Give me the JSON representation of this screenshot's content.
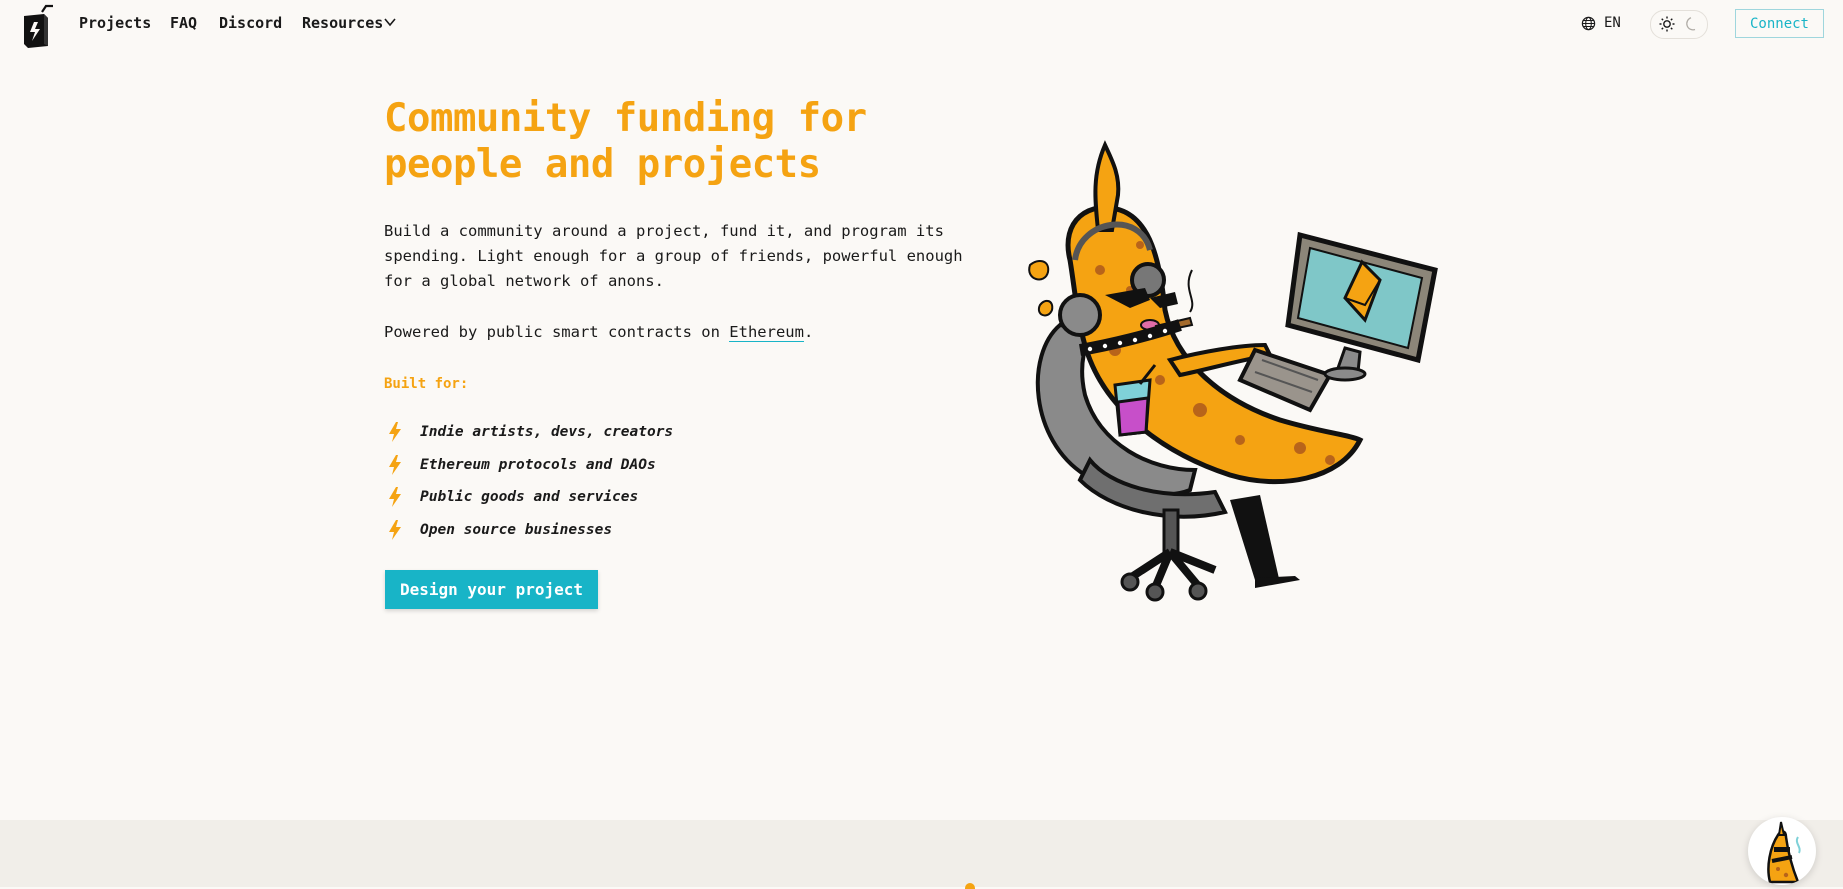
{
  "nav": {
    "links": [
      "Projects",
      "FAQ",
      "Discord",
      "Resources"
    ],
    "language": "EN",
    "connect_label": "Connect"
  },
  "hero": {
    "title_line1": "Community funding for",
    "title_line2": "people and projects",
    "description": "Build a community around a project, fund it, and program its spending. Light enough for a group of friends, powerful enough for a global network of anons.",
    "powered_prefix": "Powered by public smart contracts on ",
    "powered_link": "Ethereum",
    "powered_suffix": ".",
    "built_for_label": "Built for:",
    "built_for": [
      "Indie artists, devs, creators",
      "Ethereum protocols and DAOs",
      "Public goods and services",
      "Open source businesses"
    ],
    "cta_label": "Design your project"
  },
  "colors": {
    "accent_orange": "#f5a312",
    "accent_teal": "#18b4c7",
    "background": "#fbf9f6"
  },
  "icons": {
    "logo": "juice-box-logo",
    "language": "globe-icon",
    "theme_light": "sun-icon",
    "theme_dark": "moon-icon",
    "bullet": "lightning-bolt-icon",
    "dropdown": "chevron-down-icon",
    "help": "banana-mascot-avatar"
  }
}
